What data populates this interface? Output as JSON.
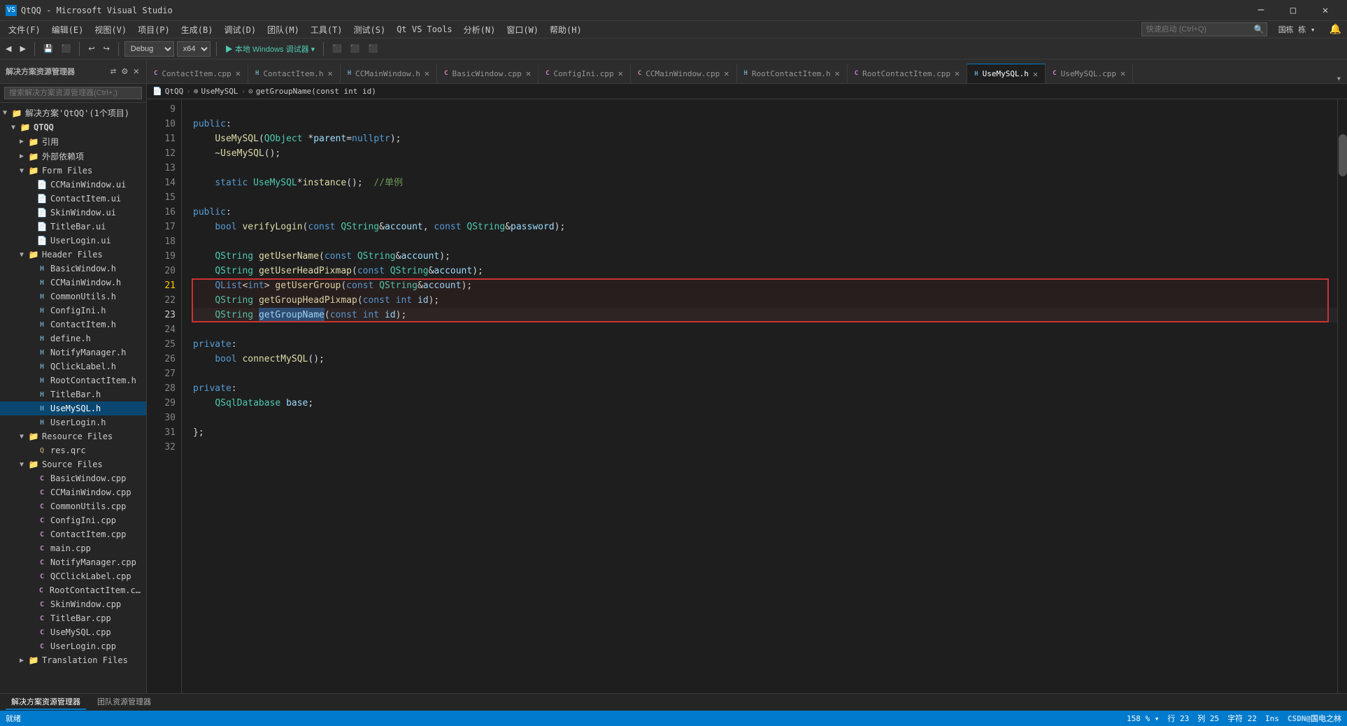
{
  "titleBar": {
    "title": "QtQQ - Microsoft Visual Studio",
    "icon": "VS",
    "controls": [
      "minimize",
      "maximize",
      "close"
    ]
  },
  "menuBar": {
    "items": [
      "文件(F)",
      "编辑(E)",
      "视图(V)",
      "项目(P)",
      "生成(B)",
      "调试(D)",
      "团队(M)",
      "工具(T)",
      "测试(S)",
      "Qt VS Tools",
      "分析(N)",
      "窗口(W)",
      "帮助(H)"
    ],
    "searchPlaceholder": "快速启动 (Ctrl+Q)"
  },
  "toolbar": {
    "debugMode": "Debug",
    "platform": "x64",
    "runLabel": "本地 Windows 调试器",
    "btnLabels": [
      "▶",
      "‖",
      "⬛",
      "↺"
    ]
  },
  "sidebar": {
    "title": "解决方案资源管理器",
    "searchPlaceholder": "搜索解决方案资源管理器(Ctrl+;)",
    "tree": {
      "root": "解决方案'QtQQ'(1个项目)",
      "project": "QTQQ",
      "sections": [
        {
          "name": "引用",
          "indent": 1,
          "type": "folder",
          "expanded": false
        },
        {
          "name": "外部依赖项",
          "indent": 1,
          "type": "folder",
          "expanded": false
        },
        {
          "name": "Form Files",
          "indent": 1,
          "type": "folder",
          "expanded": true,
          "children": [
            {
              "name": "CCMainWindow.ui",
              "indent": 2,
              "type": "ui"
            },
            {
              "name": "ContactItem.ui",
              "indent": 2,
              "type": "ui"
            },
            {
              "name": "SkinWindow.ui",
              "indent": 2,
              "type": "ui"
            },
            {
              "name": "TitleBar.ui",
              "indent": 2,
              "type": "ui"
            },
            {
              "name": "UserLogin.ui",
              "indent": 2,
              "type": "ui"
            }
          ]
        },
        {
          "name": "Header Files",
          "indent": 1,
          "type": "folder",
          "expanded": true,
          "children": [
            {
              "name": "BasicWindow.h",
              "indent": 2,
              "type": "h"
            },
            {
              "name": "CCMainWindow.h",
              "indent": 2,
              "type": "h"
            },
            {
              "name": "CommonUtils.h",
              "indent": 2,
              "type": "h"
            },
            {
              "name": "ConfigIni.h",
              "indent": 2,
              "type": "h"
            },
            {
              "name": "ContactItem.h",
              "indent": 2,
              "type": "h"
            },
            {
              "name": "define.h",
              "indent": 2,
              "type": "h"
            },
            {
              "name": "NotifyManager.h",
              "indent": 2,
              "type": "h"
            },
            {
              "name": "QClickLabel.h",
              "indent": 2,
              "type": "h"
            },
            {
              "name": "RootContactItem.h",
              "indent": 2,
              "type": "h"
            },
            {
              "name": "TitleBar.h",
              "indent": 2,
              "type": "h"
            },
            {
              "name": "UseMySQL.h",
              "indent": 2,
              "type": "h",
              "active": true
            },
            {
              "name": "UserLogin.h",
              "indent": 2,
              "type": "h"
            }
          ]
        },
        {
          "name": "Resource Files",
          "indent": 1,
          "type": "folder",
          "expanded": true,
          "children": [
            {
              "name": "res.qrc",
              "indent": 2,
              "type": "qrc"
            }
          ]
        },
        {
          "name": "Source Files",
          "indent": 1,
          "type": "folder",
          "expanded": true,
          "children": [
            {
              "name": "BasicWindow.cpp",
              "indent": 2,
              "type": "cpp"
            },
            {
              "name": "CCMainWindow.cpp",
              "indent": 2,
              "type": "cpp"
            },
            {
              "name": "CommonUtils.cpp",
              "indent": 2,
              "type": "cpp"
            },
            {
              "name": "ConfigIni.cpp",
              "indent": 2,
              "type": "cpp"
            },
            {
              "name": "ContactItem.cpp",
              "indent": 2,
              "type": "cpp"
            },
            {
              "name": "main.cpp",
              "indent": 2,
              "type": "cpp"
            },
            {
              "name": "NotifyManager.cpp",
              "indent": 2,
              "type": "cpp"
            },
            {
              "name": "QCClickLabel.cpp",
              "indent": 2,
              "type": "cpp"
            },
            {
              "name": "RootContactItem.cpp",
              "indent": 2,
              "type": "cpp"
            },
            {
              "name": "SkinWindow.cpp",
              "indent": 2,
              "type": "cpp"
            },
            {
              "name": "TitleBar.cpp",
              "indent": 2,
              "type": "cpp"
            },
            {
              "name": "UseMySQL.cpp",
              "indent": 2,
              "type": "cpp"
            },
            {
              "name": "UserLogin.cpp",
              "indent": 2,
              "type": "cpp"
            }
          ]
        },
        {
          "name": "Translation Files",
          "indent": 1,
          "type": "folder",
          "expanded": false
        }
      ]
    }
  },
  "tabs": [
    {
      "label": "ContactItem.cpp",
      "type": "cpp",
      "active": false
    },
    {
      "label": "ContactItem.h",
      "type": "h",
      "active": false
    },
    {
      "label": "CCMainWindow.h",
      "type": "h",
      "active": false
    },
    {
      "label": "BasicWindow.cpp",
      "type": "cpp",
      "active": false
    },
    {
      "label": "ConfigIni.cpp",
      "type": "cpp",
      "active": false
    },
    {
      "label": "CCMainWindow.cpp",
      "type": "cpp",
      "active": false
    },
    {
      "label": "RootContactItem.h",
      "type": "h",
      "active": false
    },
    {
      "label": "RootContactItem.cpp",
      "type": "cpp",
      "active": false
    },
    {
      "label": "UseMySQL.h",
      "type": "h",
      "active": true,
      "modified": false
    },
    {
      "label": "UseMySQL.cpp",
      "type": "cpp",
      "active": false
    }
  ],
  "breadcrumb": {
    "items": [
      "QtQQ",
      "UseMySQL",
      "getGroupName(const int id)"
    ]
  },
  "codeLines": [
    {
      "num": 9,
      "content": ""
    },
    {
      "num": 10,
      "content": "public:"
    },
    {
      "num": 11,
      "content": "    UseMySQL(QObject *parent=nullptr);"
    },
    {
      "num": 12,
      "content": "    ~UseMySQL();"
    },
    {
      "num": 13,
      "content": ""
    },
    {
      "num": 14,
      "content": "    static UseMySQL*instance();  //单例"
    },
    {
      "num": 15,
      "content": ""
    },
    {
      "num": 16,
      "content": "public:"
    },
    {
      "num": 17,
      "content": "    bool verifyLogin(const QString&account, const QString&password);"
    },
    {
      "num": 18,
      "content": ""
    },
    {
      "num": 19,
      "content": "    QString getUserName(const QString&account);"
    },
    {
      "num": 20,
      "content": "    QString getUserHeadPixmap(const QString&account);"
    },
    {
      "num": 21,
      "content": "    QList<int> getUserGroup(const QString&account);"
    },
    {
      "num": 22,
      "content": "    QString getGroupHeadPixmap(const int id);"
    },
    {
      "num": 23,
      "content": "    QString getGroupName(const int id);"
    },
    {
      "num": 24,
      "content": ""
    },
    {
      "num": 25,
      "content": "private:"
    },
    {
      "num": 26,
      "content": "    bool connectMySQL();"
    },
    {
      "num": 27,
      "content": ""
    },
    {
      "num": 28,
      "content": "private:"
    },
    {
      "num": 29,
      "content": "    QSqlDatabase base;"
    },
    {
      "num": 30,
      "content": ""
    },
    {
      "num": 31,
      "content": "};"
    },
    {
      "num": 32,
      "content": ""
    }
  ],
  "statusBar": {
    "message": "就绪",
    "row": "行 23",
    "col": "列 25",
    "char": "字符 22",
    "ins": "Ins",
    "zoom": "158 %",
    "encoding": "",
    "lineEnding": ""
  },
  "bottomTabs": [
    {
      "label": "解决方案资源管理器",
      "active": true
    },
    {
      "label": "团队资源管理器",
      "active": false
    }
  ],
  "watermark": "CSDN@国电之林"
}
